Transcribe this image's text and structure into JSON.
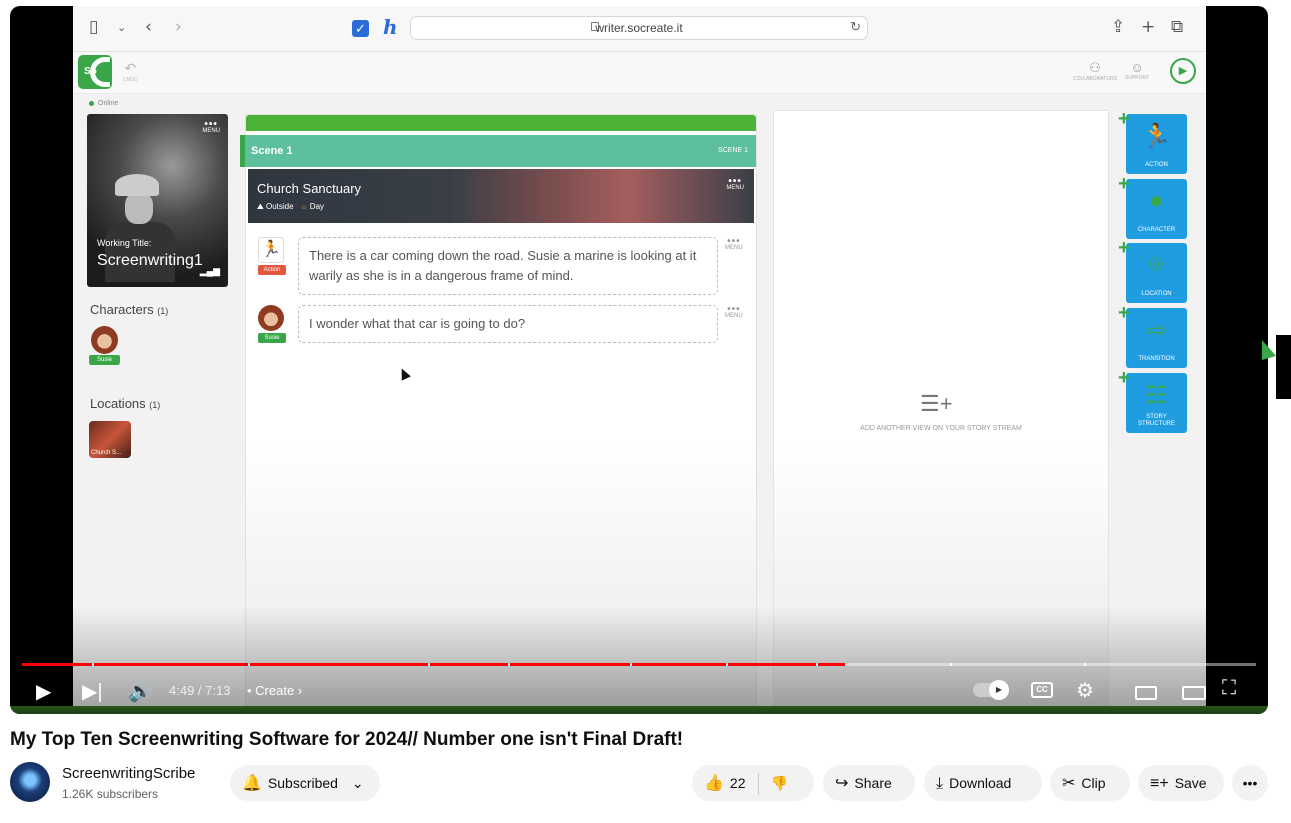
{
  "browser": {
    "url": "writer.socreate.it"
  },
  "app": {
    "logo_text": "So",
    "undo_label": "UNDO",
    "collaborators_label": "COLLABORATORS",
    "support_label": "SUPPORT",
    "online_label": "Online",
    "poster": {
      "menu_label": "MENU",
      "working_title_label": "Working Title:",
      "title": "Screenwriting1"
    },
    "characters_label": "Characters",
    "characters_count": "(1)",
    "character_name": "Susie",
    "locations_label": "Locations",
    "locations_count": "(1)",
    "location_thumb_caption": "Church S...",
    "scene": {
      "title": "Scene 1",
      "right_label": "SCENE 1",
      "location_title": "Church Sanctuary",
      "location_setting": "Outside",
      "location_time": "Day",
      "menu_label": "MENU"
    },
    "beats": [
      {
        "type_label": "Action",
        "text": "There is a car coming down the road.  Susie a marine is looking at it warily as she is in a dangerous frame of mind.",
        "menu_label": "MENU"
      },
      {
        "type_label": "Susie",
        "text": "I wonder what that car is going to do?",
        "menu_label": "MENU"
      }
    ],
    "stream_hint": "ADD ANOTHER VIEW ON YOUR STORY STREAM",
    "tools": [
      {
        "label": "ACTION",
        "icon": "running-person-icon"
      },
      {
        "label": "CHARACTER",
        "icon": "person-icon"
      },
      {
        "label": "LOCATION",
        "icon": "map-pin-icon"
      },
      {
        "label": "TRANSITION",
        "icon": "arrow-box-icon"
      },
      {
        "label": "STORY STRUCTURE",
        "icon": "structure-icon"
      }
    ]
  },
  "player": {
    "time": "4:49 / 7:13",
    "chapter": "Create",
    "progress": 0.667
  },
  "video": {
    "title": "My Top Ten Screenwriting Software for 2024// Number one isn't Final Draft!",
    "channel": "ScreenwritingScribe",
    "subscribers": "1.26K subscribers",
    "subscribed_label": "Subscribed",
    "likes": "22",
    "share_label": "Share",
    "download_label": "Download",
    "clip_label": "Clip",
    "save_label": "Save"
  }
}
